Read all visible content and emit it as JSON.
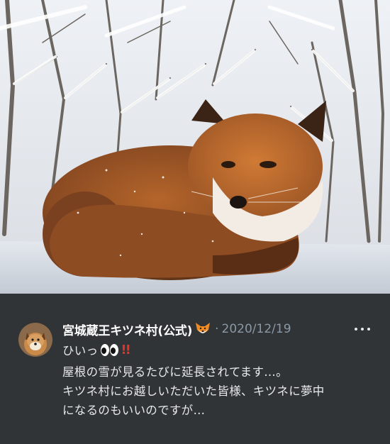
{
  "photo": {
    "alt": "キツネの写真"
  },
  "post": {
    "author_name": "宮城蔵王キツネ村(公式)",
    "author_emoji": "fox-face-icon",
    "separator": "·",
    "date": "2020/12/19",
    "more_icon": "more-options-icon",
    "text_line1": "ひいっ",
    "text_line1_emoji": "eyes-icon",
    "text_line1_marks": "!!",
    "text_line2": "屋根の雪が見るたびに延長されてます…。",
    "text_line3": "キツネ村にお越しいただいた皆様、キツネに夢中",
    "text_line4": "になるのもいいのですが…"
  },
  "colors": {
    "background": "#303437",
    "text": "#e7e9ea",
    "muted": "#8b98a5",
    "accent_red": "#e0342b"
  }
}
